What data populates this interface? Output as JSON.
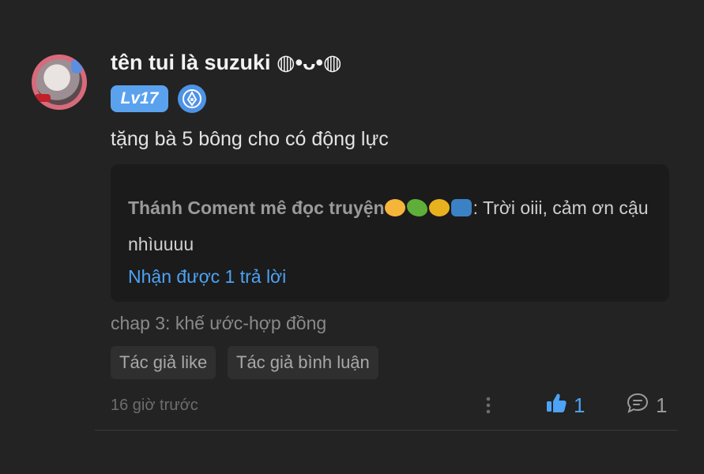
{
  "comment": {
    "username": "tên tui là suzuki ◍•ᴗ•◍",
    "level": "Lv17",
    "text": "tặng bà 5 bông cho có động lực",
    "reply": {
      "author": "Thánh Coment mê đọc truyện",
      "separator": ": ",
      "text": "Trời oiii, cảm ơn cậu nhìuuuu",
      "count_label": "Nhận được 1 trả lời"
    },
    "chapter": "chap 3: khế ước-hợp đồng",
    "tags": [
      "Tác giả like",
      "Tác giả bình luận"
    ],
    "timestamp": "16 giờ trước",
    "likes": "1",
    "replies": "1"
  },
  "colors": {
    "background": "#232323",
    "reply_background": "#1b1b1b",
    "accent": "#4da3f5",
    "level_badge": "#5aa2ee"
  },
  "icons": {
    "like": "thumbs-up-icon",
    "comment": "speech-bubble-icon",
    "more": "vertical-dots-icon",
    "badge": "pen-nib-icon"
  }
}
